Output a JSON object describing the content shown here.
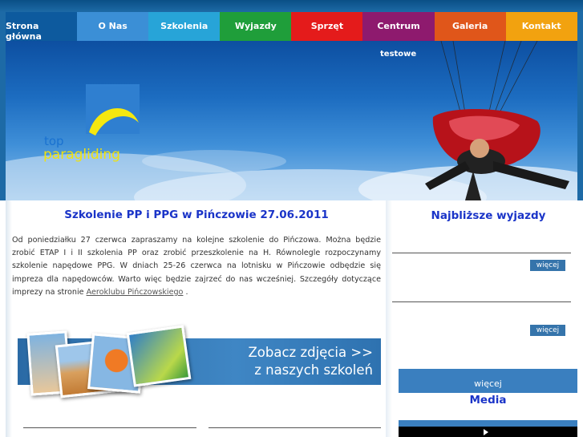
{
  "colors": {
    "nav": [
      "#0d5a9e",
      "#3b8fd6",
      "#27a4d8",
      "#1f9e3a",
      "#e41b1b",
      "#8e1a6e",
      "#e0561a",
      "#f2a20f"
    ],
    "title": "#1a34c8",
    "frame": "#1d6aa6"
  },
  "nav": {
    "items": [
      {
        "label": "Strona główna"
      },
      {
        "label": "O Nas"
      },
      {
        "label": "Szkolenia"
      },
      {
        "label": "Wyjazdy"
      },
      {
        "label": "Sprzęt"
      },
      {
        "label": "Centrum"
      },
      {
        "label": "Galeria"
      },
      {
        "label": "Kontakt"
      }
    ],
    "sub_label": "testowe"
  },
  "logo": {
    "line1": "top",
    "line2": "paragliding"
  },
  "article": {
    "title": "Szkolenie PP i PPG w Pińczowie 27.06.2011",
    "body": "Od poniedziałku 27 czerwca zapraszamy na kolejne szkolenie do Pińczowa. Można będzie zrobić ETAP I i II szkolenia PP oraz zrobić przeszkolenie na H. Równolegle rozpoczynamy szkolenie napędowe PPG. W dniach 25-26 czerwca na lotnisku w Pińczowie odbędzie się impreza dla napędowców. Warto więc będzie zajrzeć do nas wcześniej. Szczegóły dotyczące imprezy na stronie ",
    "link": "Aeroklubu Pińczowskiego",
    "end": " ."
  },
  "banner": {
    "line1": "Zobacz zdjęcia >>",
    "line2": "z naszych szkoleń"
  },
  "sidebar": {
    "title": "Najbliższe wyjazdy",
    "more1": "więcej",
    "more2": "więcej",
    "more_bar": "więcej",
    "media_title": "Media"
  },
  "icons": [
    "play-icon"
  ]
}
